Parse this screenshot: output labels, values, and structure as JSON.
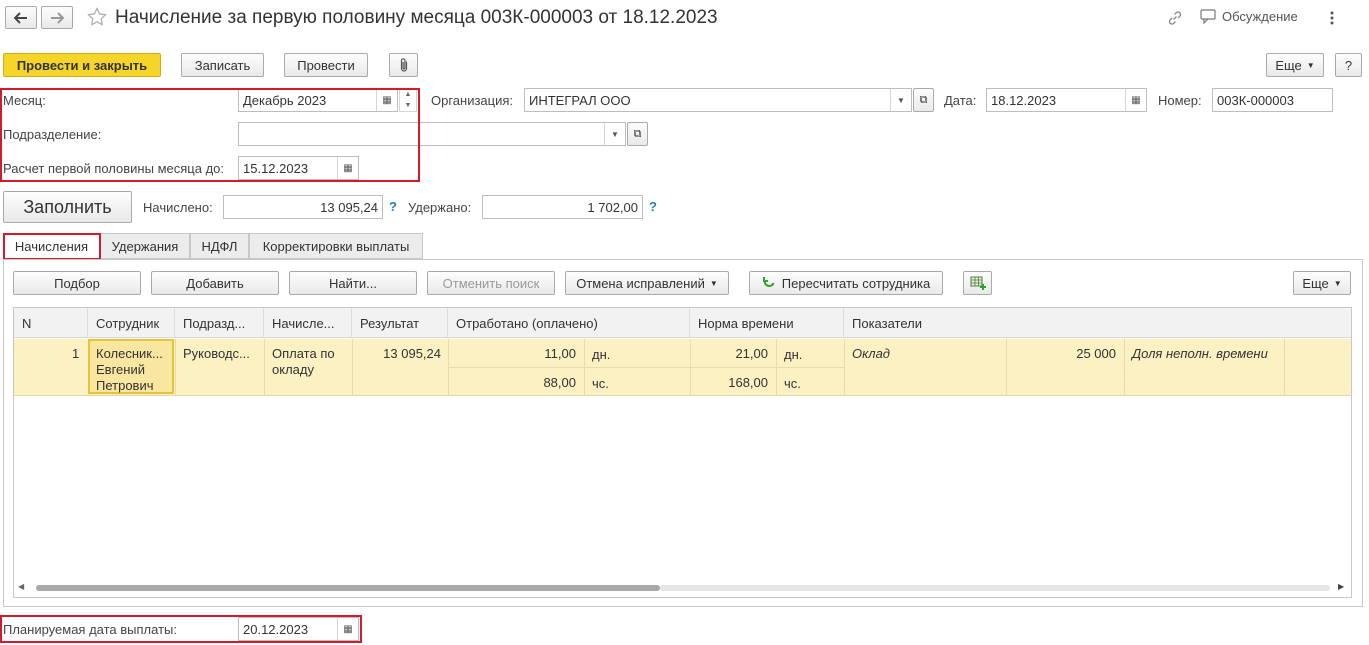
{
  "header": {
    "title": "Начисление за первую половину месяца 003К-000003 от 18.12.2023",
    "discussion_label": "Обсуждение"
  },
  "toolbar": {
    "post_close": "Провести и закрыть",
    "save": "Записать",
    "post": "Провести",
    "more": "Еще",
    "help": "?"
  },
  "form": {
    "month_label": "Месяц:",
    "month_value": "Декабрь 2023",
    "org_label": "Организация:",
    "org_value": "ИНТЕГРАЛ ООО",
    "date_label": "Дата:",
    "date_value": "18.12.2023",
    "number_label": "Номер:",
    "number_value": "003К-000003",
    "division_label": "Подразделение:",
    "division_value": "",
    "calc_until_label": "Расчет первой половины месяца до:",
    "calc_until_value": "15.12.2023",
    "fill_button": "Заполнить",
    "accrued_label": "Начислено:",
    "accrued_value": "13 095,24",
    "withheld_label": "Удержано:",
    "withheld_value": "1 702,00",
    "payment_date_label": "Планируемая дата выплаты:",
    "payment_date_value": "20.12.2023"
  },
  "tabs": [
    {
      "label": "Начисления",
      "active": true
    },
    {
      "label": "Удержания",
      "active": false
    },
    {
      "label": "НДФЛ",
      "active": false
    },
    {
      "label": "Корректировки выплаты",
      "active": false
    }
  ],
  "table_toolbar": {
    "pick": "Подбор",
    "add": "Добавить",
    "find": "Найти...",
    "cancel_search": "Отменить поиск",
    "cancel_corrections": "Отмена исправлений",
    "recalc": "Пересчитать сотрудника",
    "more": "Еще"
  },
  "table": {
    "columns": [
      "N",
      "Сотрудник",
      "Подразд...",
      "Начисле...",
      "Результат",
      "Отработано (оплачено)",
      "Норма времени",
      "Показатели"
    ],
    "rows": [
      {
        "n": "1",
        "employee": [
          "Колесник...",
          "Евгений",
          "Петрович"
        ],
        "division": "Руководс...",
        "accrual": [
          "Оплата по",
          "окладу"
        ],
        "result": "13 095,24",
        "worked_days": "11,00",
        "worked_days_unit": "дн.",
        "worked_hours": "88,00",
        "worked_hours_unit": "чс.",
        "norm_days": "21,00",
        "norm_days_unit": "дн.",
        "norm_hours": "168,00",
        "norm_hours_unit": "чс.",
        "indicator_name": "Оклад",
        "indicator_value": "25 000",
        "indicator_name2": "Доля неполн. времени"
      }
    ]
  },
  "colors": {
    "accent_yellow": "#f6d52a",
    "highlight_red": "#d21c2c",
    "row_selected": "#fbf1c2",
    "help_blue": "#2a7bbf"
  }
}
